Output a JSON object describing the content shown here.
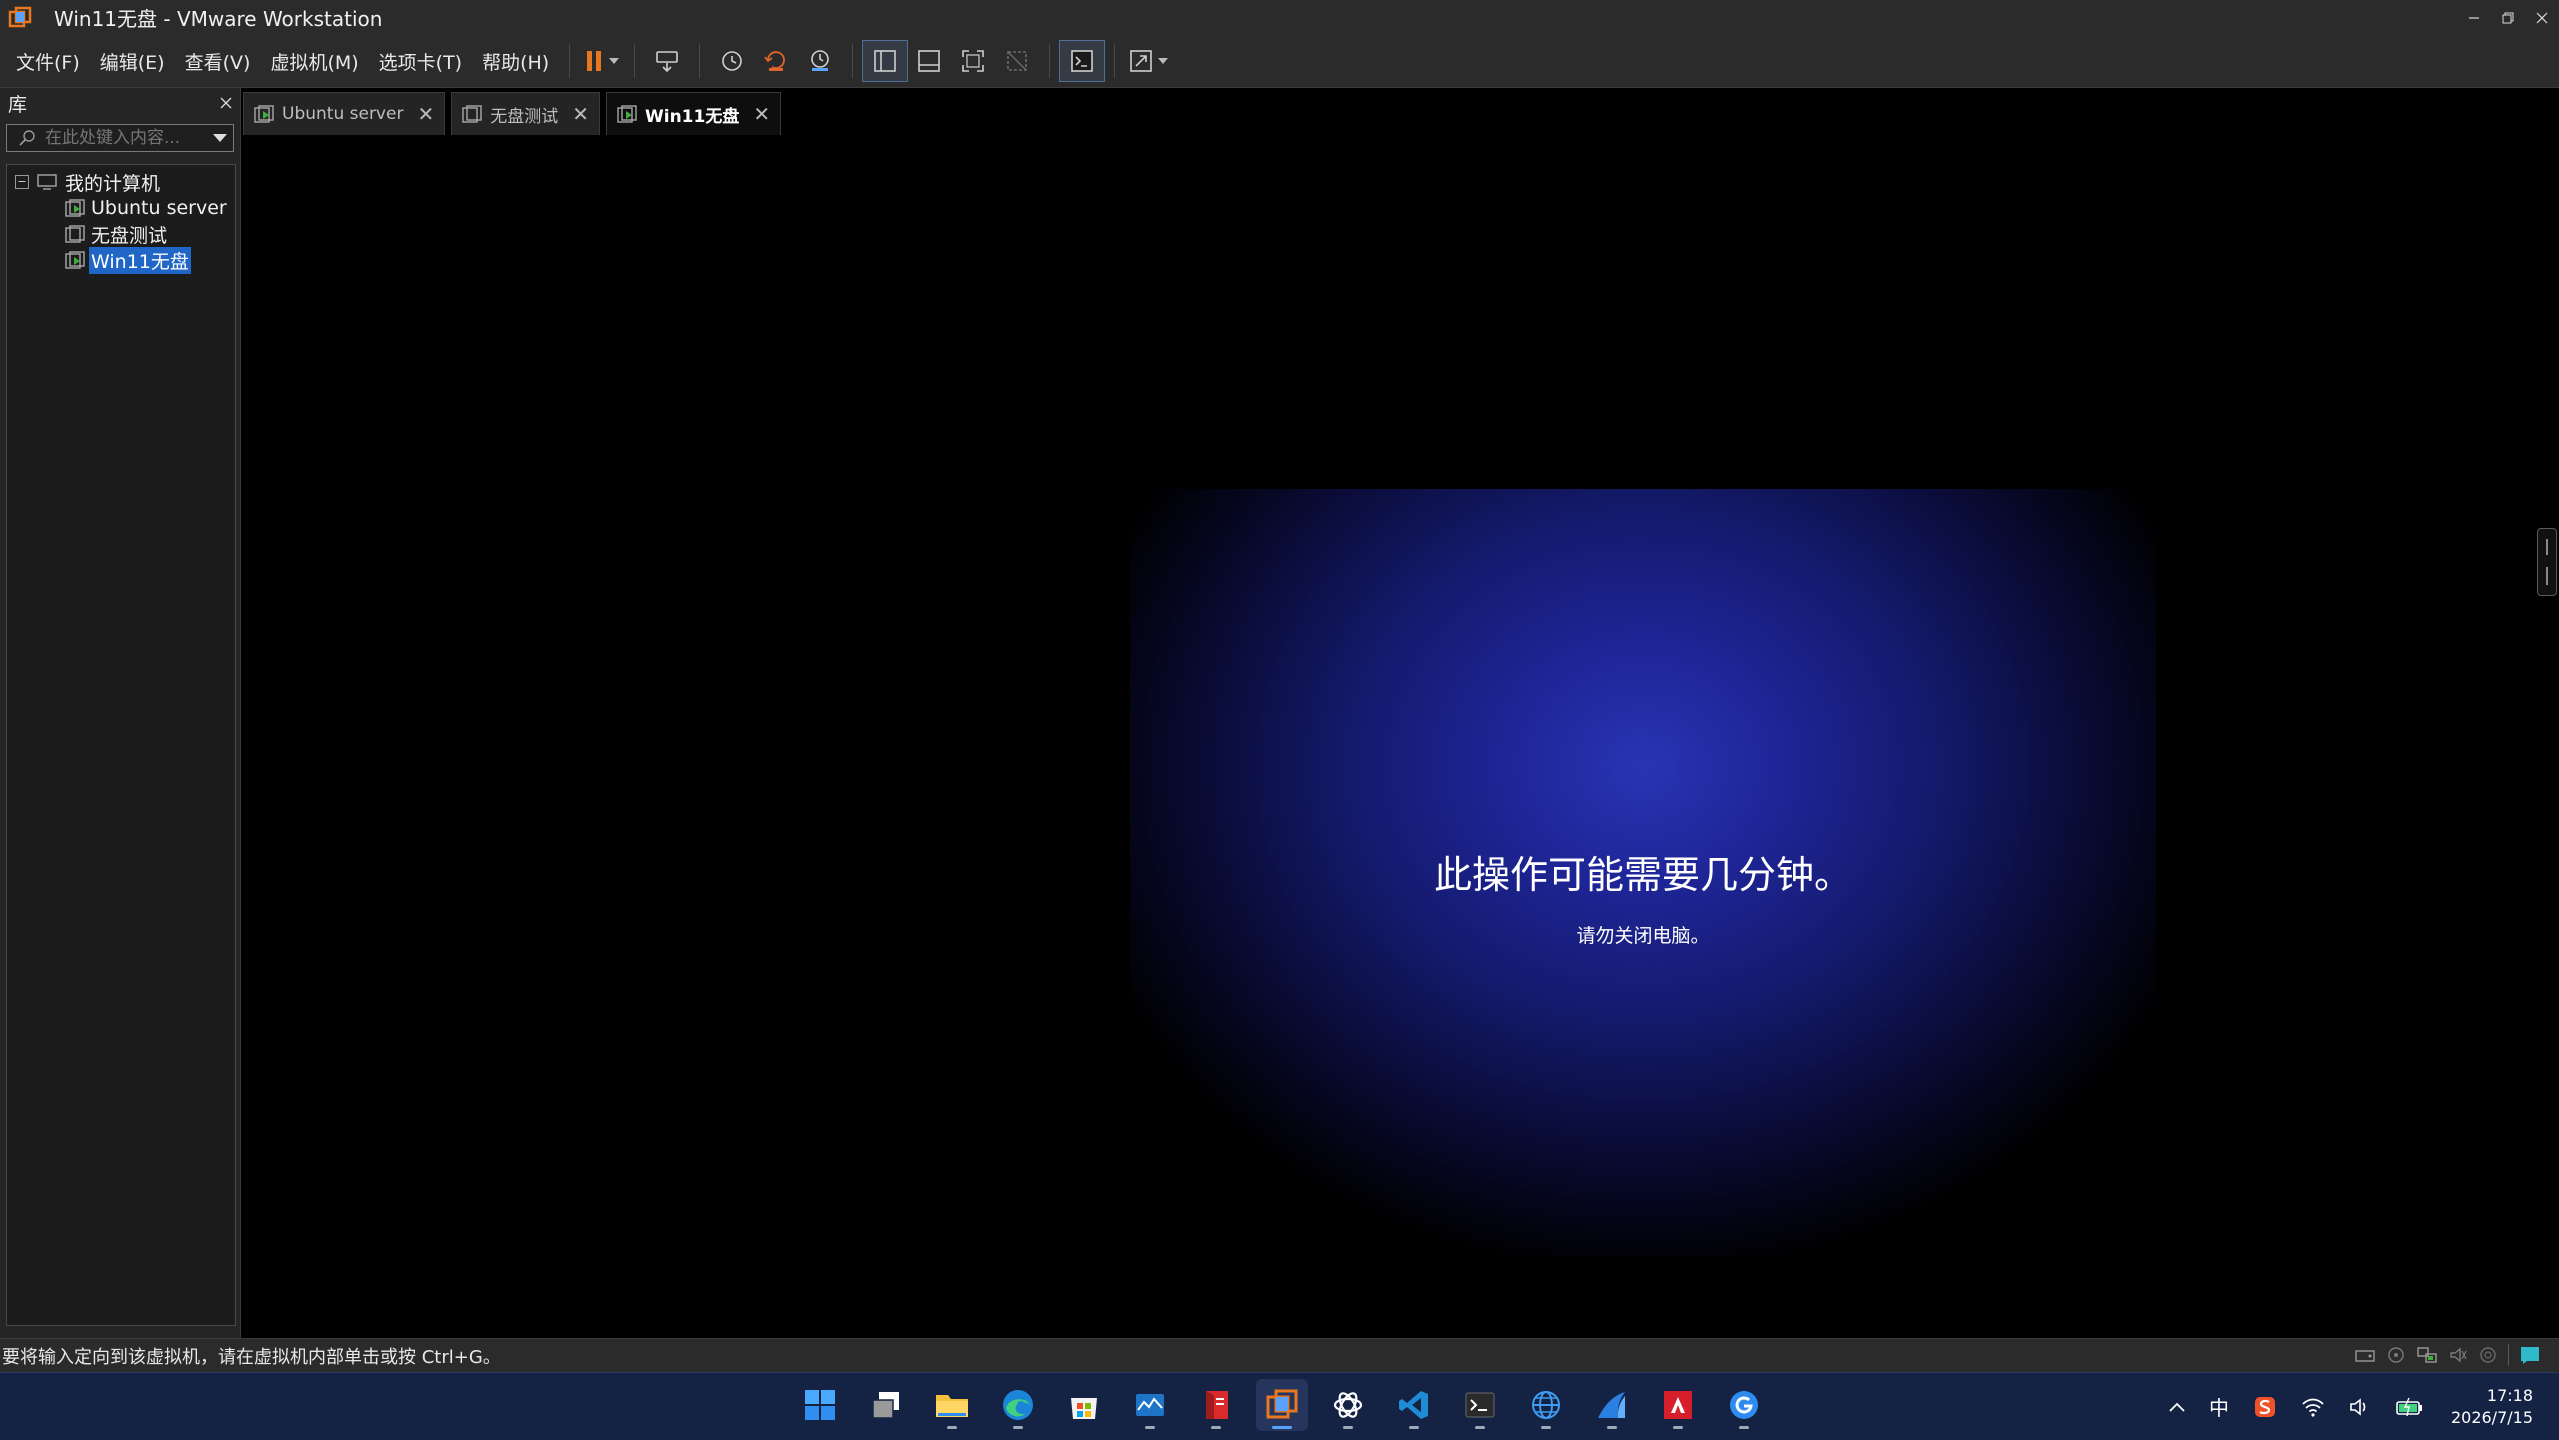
{
  "window": {
    "title": "Win11无盘 - VMware Workstation"
  },
  "menu": [
    "文件(F)",
    "编辑(E)",
    "查看(V)",
    "虚拟机(M)",
    "选项卡(T)",
    "帮助(H)"
  ],
  "library": {
    "title": "库",
    "search_placeholder": "在此处键入内容...",
    "root": "我的计算机",
    "vms": [
      "Ubuntu server",
      "无盘测试",
      "Win11无盘"
    ],
    "selected_vm": "Win11无盘"
  },
  "tabs": [
    {
      "label": "Ubuntu server",
      "active": false
    },
    {
      "label": "无盘测试",
      "active": false
    },
    {
      "label": "Win11无盘",
      "active": true
    }
  ],
  "vm_screen": {
    "message": "此操作可能需要几分钟。",
    "submessage": "请勿关闭电脑。",
    "colors": {
      "center": "#2a34b4",
      "edge": "#000000"
    }
  },
  "status_bar": {
    "hint": "要将输入定向到该虚拟机，请在虚拟机内部单击或按 Ctrl+G。"
  },
  "taskbar": {
    "apps": [
      "start-icon",
      "task-view-icon",
      "file-explorer-icon",
      "edge-icon",
      "store-icon",
      "monitor-app-icon",
      "document-app-icon",
      "vmware-icon",
      "chatgpt-icon",
      "vscode-icon",
      "terminal-icon",
      "globe-icon",
      "shark-app-icon",
      "amd-icon",
      "google-icon"
    ],
    "active_app": "vmware-icon",
    "ime": "中",
    "time": "17:18",
    "date": "2026/7/15"
  },
  "accent": {
    "pause": "#e87722",
    "selection": "#1f66c7",
    "taskbar": "#142244"
  }
}
